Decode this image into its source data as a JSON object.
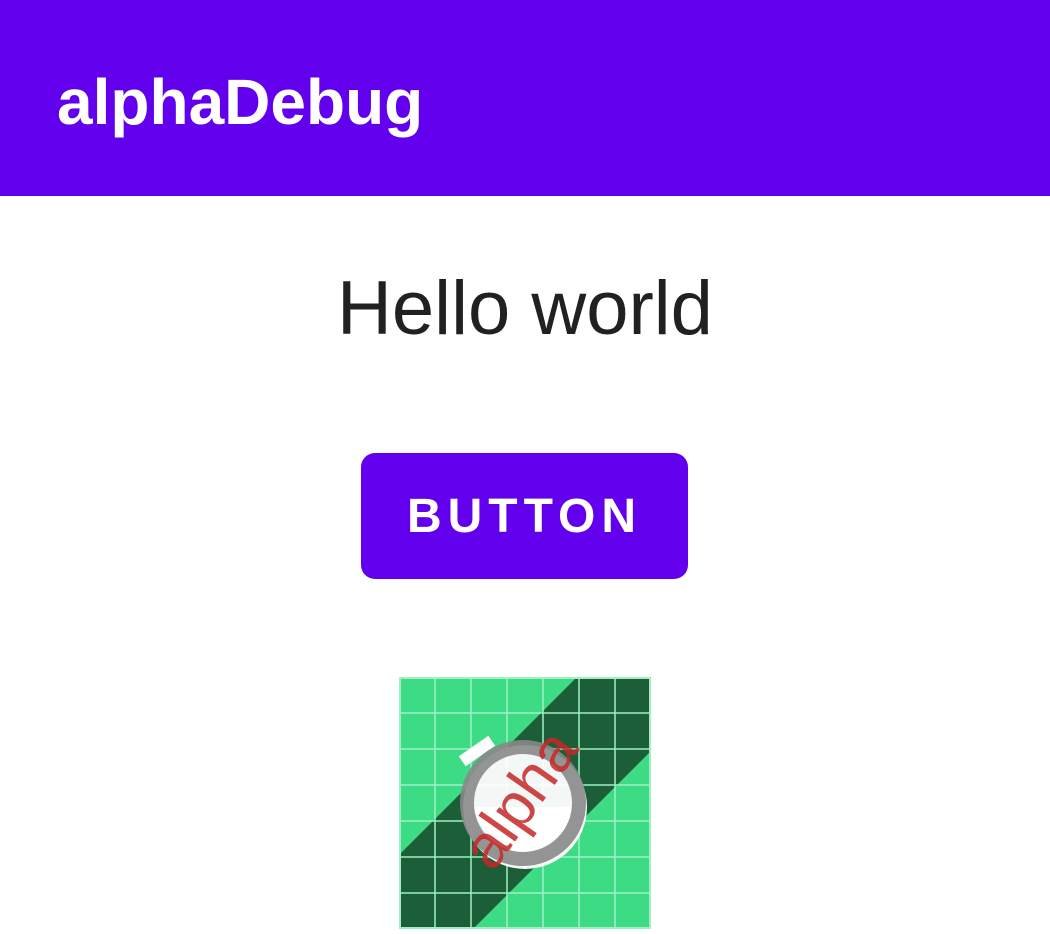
{
  "app_bar": {
    "title": "alphaDebug",
    "color": "#6200ee"
  },
  "main": {
    "greeting": "Hello world",
    "button_label": "BUTTON",
    "launcher_icon": {
      "name": "alpha-launcher-icon",
      "badge_text": "alpha"
    }
  }
}
